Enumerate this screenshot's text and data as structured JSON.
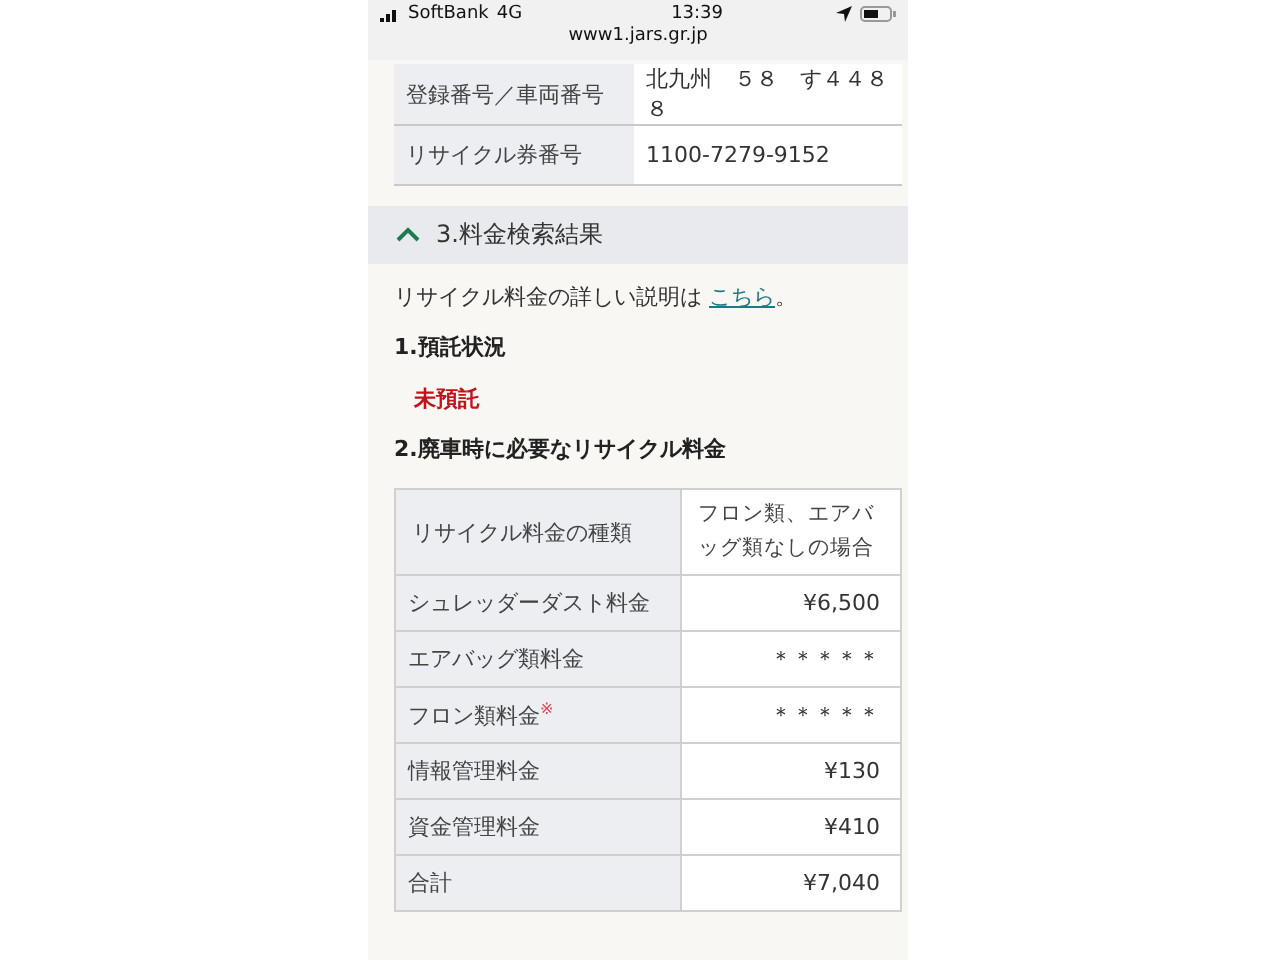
{
  "status_bar": {
    "carrier": "SoftBank",
    "network": "4G",
    "time": "13:39",
    "url": "www1.jars.gr.jp"
  },
  "vehicle_table": [
    {
      "label": "登録番号／車両番号",
      "value": "北九州　５８　す４４８８"
    },
    {
      "label": "リサイクル券番号",
      "value": "1100-7279-9152"
    }
  ],
  "section": {
    "title": "3.料金検索結果",
    "expanded": true
  },
  "intro": {
    "text": "リサイクル料金の詳しい説明は ",
    "link": "こちら",
    "end": "。"
  },
  "deposit": {
    "heading": "1.預託状況",
    "status": "未預託"
  },
  "fees": {
    "heading": "2.廃車時に必要なリサイクル料金",
    "columns": [
      "リサイクル料金の種類",
      "フロン類、エアバッグ類なしの場合"
    ],
    "rows": [
      {
        "label": "シュレッダーダスト料金",
        "value": "¥6,500"
      },
      {
        "label": "エアバッグ類料金",
        "value": "＊＊＊＊＊"
      },
      {
        "label": "フロン類料金$^{※}$",
        "value": "＊＊＊＊＊"
      },
      {
        "label": "情報管理料金",
        "value": "¥130"
      },
      {
        "label": "資金管理料金",
        "value": "¥410"
      },
      {
        "label": "合計",
        "value": "¥7,040"
      }
    ]
  }
}
